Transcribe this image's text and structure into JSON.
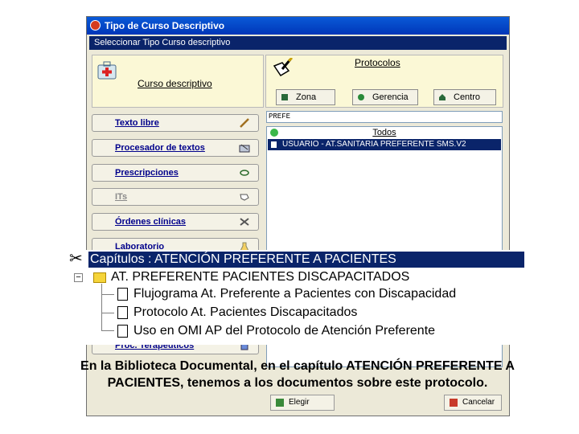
{
  "window": {
    "title": "Tipo de Curso Descriptivo",
    "subtitle": "Seleccionar Tipo Curso descriptivo"
  },
  "panel_left": {
    "label": "Curso descriptivo",
    "icon": "medical-kit-icon"
  },
  "panel_right": {
    "label": "Protocolos",
    "icon": "notebook-pencil-icon",
    "buttons": [
      {
        "label": "Zona",
        "icon": "zona-icon"
      },
      {
        "label": "Gerencia",
        "icon": "gerencia-icon"
      },
      {
        "label": "Centro",
        "icon": "centro-icon"
      }
    ]
  },
  "left_buttons": [
    {
      "label": "Texto libre",
      "icon": "pencil-icon"
    },
    {
      "label": "Procesador de textos",
      "icon": "word-processor-icon"
    },
    {
      "label": "Prescripciones",
      "icon": "prescription-icon"
    },
    {
      "label": "ITs",
      "icon": "hand-icon"
    },
    {
      "label": "Órdenes clínicas",
      "icon": "tools-icon"
    },
    {
      "label": "Laboratorio",
      "icon": "lab-icon"
    },
    {
      "label": "Proc. Terapéuticos",
      "icon": "therapy-icon"
    }
  ],
  "filter": {
    "value": "PREFE"
  },
  "list": {
    "header": "Todos",
    "rows": [
      "USUARIO - AT.SANITARIA PREFERENTE SMS.V2"
    ]
  },
  "footer": {
    "ok": "Elegir",
    "cancel": "Cancelar"
  },
  "tree": {
    "chapter": "Capítulos   : ATENCIÓN PREFERENTE A PACIENTES",
    "folder": "AT. PREFERENTE PACIENTES DISCAPACITADOS",
    "docs": [
      "Flujograma At. Preferente a Pacientes con Discapacidad",
      "Protocolo At. Pacientes Discapacitados",
      "Uso en OMI AP del Protocolo de Atención Preferente"
    ]
  },
  "caption": {
    "line1": "En la Biblioteca Documental, en el capítulo ATENCIÓN PREFERENTE A",
    "line2": "PACIENTES, tenemos a los documentos sobre este protocolo."
  },
  "colors": {
    "selection": "#0a246a",
    "titlebar": "#0036b8",
    "panel": "#fbf8d6"
  }
}
